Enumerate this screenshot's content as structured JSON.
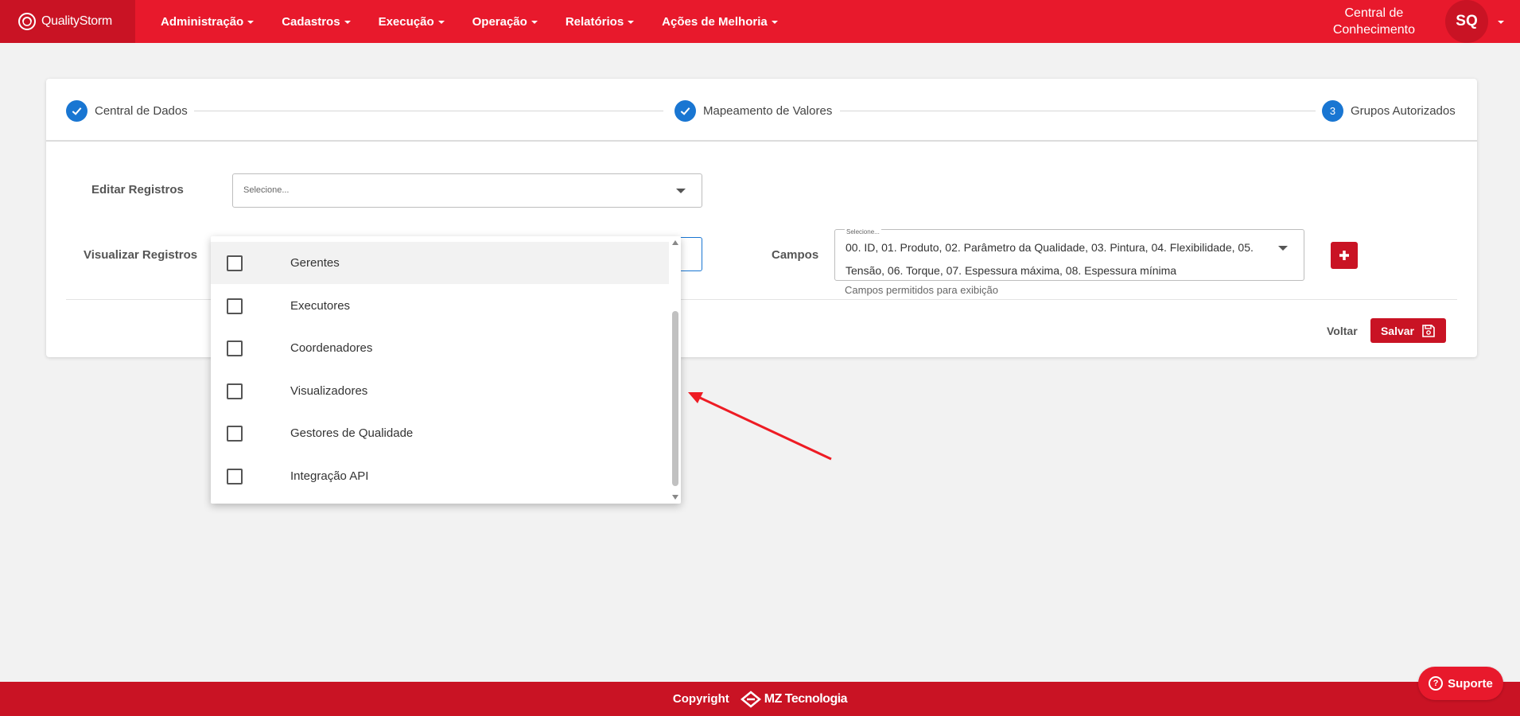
{
  "navbar": {
    "brand": "QualityStorm",
    "menu": [
      "Administração",
      "Cadastros",
      "Execução",
      "Operação",
      "Relatórios",
      "Ações de Melhoria"
    ],
    "knowledge_line1": "Central de",
    "knowledge_line2": "Conhecimento",
    "avatar_initials": "SQ"
  },
  "stepper": {
    "steps": [
      {
        "label": "Central de Dados",
        "state": "done"
      },
      {
        "label": "Mapeamento de Valores",
        "state": "done"
      },
      {
        "label": "Grupos Autorizados",
        "state": "active",
        "number": "3"
      }
    ]
  },
  "form": {
    "editar_label": "Editar Registros",
    "editar_placeholder": "Selecione...",
    "visualizar_label": "Visualizar Registros",
    "campos_label": "Campos",
    "campos_small_label": "Selecione...",
    "campos_value": "00. ID, 01. Produto, 02. Parâmetro da Qualidade, 03. Pintura, 04. Flexibilidade, 05. Tensão, 06. Torque, 07. Espessura máxima, 08. Espessura mínima",
    "campos_helper": "Campos permitidos para exibição",
    "voltar": "Voltar",
    "salvar": "Salvar"
  },
  "dropdown": {
    "options": [
      "Gerentes",
      "Executores",
      "Coordenadores",
      "Visualizadores",
      "Gestores de Qualidade",
      "Integração API"
    ]
  },
  "footer": {
    "copyright": "Copyright",
    "company": "MZ Tecnologia",
    "support": "Suporte"
  },
  "colors": {
    "primary_red": "#e8192c",
    "dark_red": "#c91324",
    "step_blue": "#1976d2"
  }
}
